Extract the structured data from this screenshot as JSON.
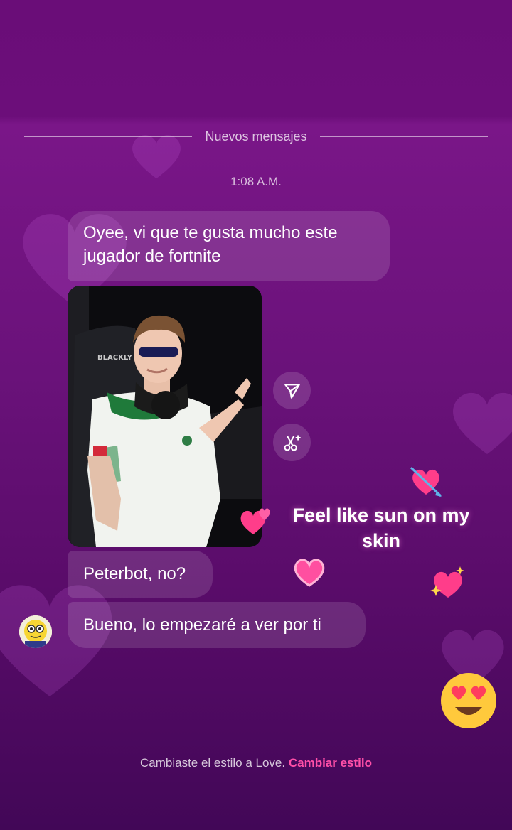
{
  "chat": {
    "separator_label": "Nuevos mensajes",
    "timestamp": "1:08 A.M.",
    "messages": [
      {
        "text": "Oyee, vi que te gusta mucho este jugador de fortnite"
      },
      {
        "text": "Peterbot, no?"
      },
      {
        "text": "Bueno, lo empezaré a ver por ti"
      }
    ],
    "photo": {
      "chair_brand": "BLACKLY"
    },
    "sticker_caption": "Feel like sun on my skin",
    "footer": {
      "notice": "Cambiaste el estilo a Love.",
      "action": "Cambiar estilo"
    }
  },
  "icons": {
    "share": "send-icon",
    "remix": "scissors-sparkle-icon",
    "avatar": "user-avatar"
  },
  "colors": {
    "theme_bg": "#6a0d78",
    "link": "#ff4fa8",
    "heart": "#ff3d8a"
  }
}
